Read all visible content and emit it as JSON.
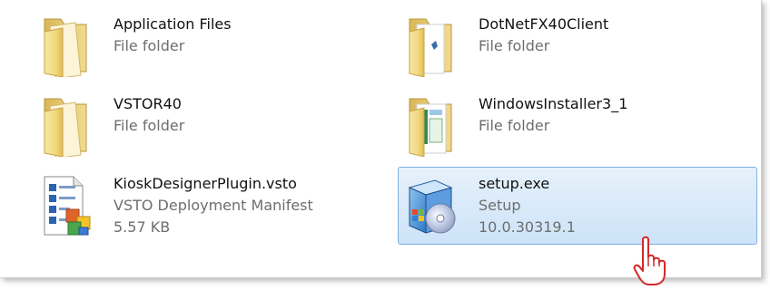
{
  "files": [
    {
      "name": "Application Files",
      "type": "File folder",
      "icon": "folder-icon"
    },
    {
      "name": "DotNetFX40Client",
      "type": "File folder",
      "icon": "folder-with-content-icon"
    },
    {
      "name": "VSTOR40",
      "type": "File folder",
      "icon": "folder-icon"
    },
    {
      "name": "WindowsInstaller3_1",
      "type": "File folder",
      "icon": "folder-with-content-icon"
    },
    {
      "name": "KioskDesignerPlugin.vsto",
      "type": "VSTO Deployment Manifest",
      "size": "5.57 KB",
      "icon": "vsto-manifest-icon"
    },
    {
      "name": "setup.exe",
      "type": "Setup",
      "version": "10.0.30319.1",
      "icon": "setup-installer-icon",
      "selected": true
    }
  ],
  "colors": {
    "selection_bg": "#cde3f8",
    "selection_border": "#7fb0e1",
    "secondary_text": "#6e6e6e"
  },
  "cursor": {
    "icon": "hand-pointer-icon"
  }
}
